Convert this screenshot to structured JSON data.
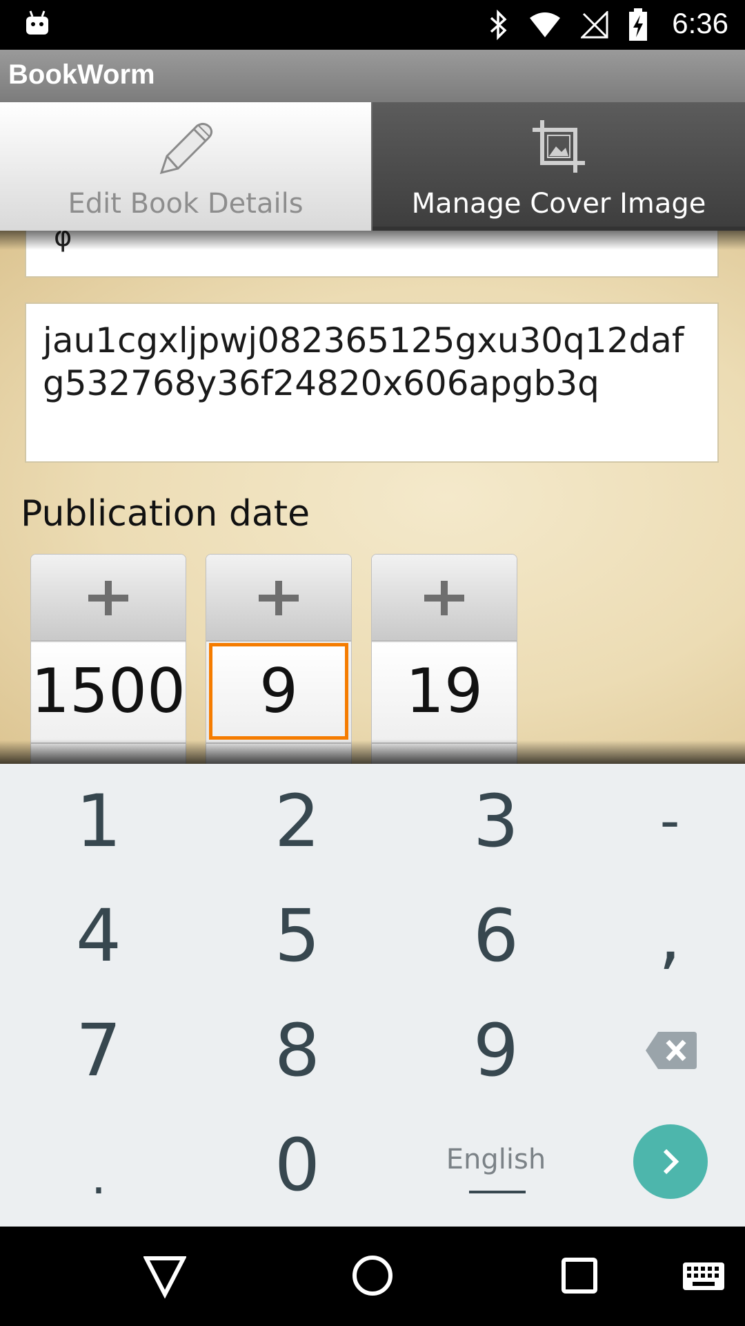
{
  "status_bar": {
    "time": "6:36",
    "icons": [
      "android-icon",
      "bluetooth-icon",
      "wifi-icon",
      "no-signal-icon",
      "battery-charging-icon"
    ]
  },
  "action_bar": {
    "title": "BookWorm"
  },
  "tabs": [
    {
      "label": "Edit Book Details",
      "icon": "pencil-icon",
      "selected": true
    },
    {
      "label": "Manage Cover Image",
      "icon": "crop-image-icon",
      "selected": false
    }
  ],
  "form": {
    "top_field_value": "φ",
    "isbn_field_value": "jau1cgxljpwj082365125gxu30q12dafg532768y36f24820x606apgb3q",
    "publication_date_label": "Publication date",
    "date_picker": {
      "year": "1500",
      "month": "9",
      "day": "19",
      "increment_label": "+",
      "focused_field": "month"
    }
  },
  "keyboard": {
    "rows": [
      [
        "1",
        "2",
        "3",
        "-"
      ],
      [
        "4",
        "5",
        "6",
        ","
      ],
      [
        "7",
        "8",
        "9",
        "backspace-icon"
      ],
      [
        ".",
        "0",
        "English",
        "go-icon"
      ]
    ],
    "language_label": "English"
  },
  "nav_bar": {
    "buttons": [
      "back-icon",
      "home-icon",
      "recents-icon",
      "keyboard-icon"
    ]
  },
  "colors": {
    "accent_focus": "#f57c00",
    "go_button": "#4db6ac",
    "keyboard_bg": "#eceff1",
    "key_text": "#37474f"
  }
}
